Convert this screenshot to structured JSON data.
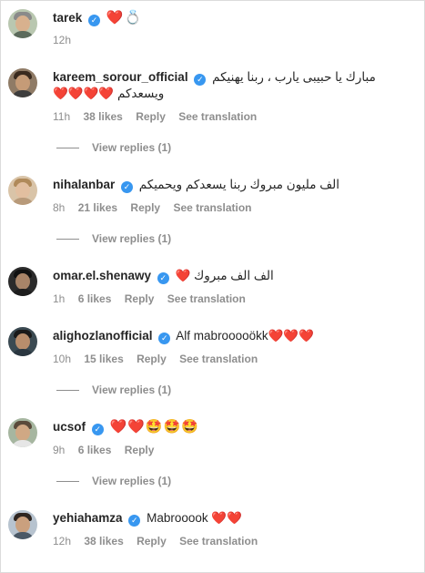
{
  "comments": [
    {
      "username": "tarek",
      "text": "❤️💍",
      "time": "12h",
      "likes": "",
      "reply": "",
      "translation": "",
      "view_replies": ""
    },
    {
      "username": "kareem_sorour_official",
      "text": "مبارك يا حبيبى يارب ، ربنا يهنيكم",
      "text2": "ويسعدكم ❤️❤️❤️❤️",
      "time": "11h",
      "likes": "38 likes",
      "reply": "Reply",
      "translation": "See translation",
      "view_replies": "View replies (1)"
    },
    {
      "username": "nihalanbar",
      "text": "الف مليون مبروك ربنا يسعدكم ويحميكم",
      "time": "8h",
      "likes": "21 likes",
      "reply": "Reply",
      "translation": "See translation",
      "view_replies": "View replies (1)"
    },
    {
      "username": "omar.el.shenawy",
      "text": "الف الف مبروك ❤️",
      "time": "1h",
      "likes": "6 likes",
      "reply": "Reply",
      "translation": "See translation",
      "view_replies": ""
    },
    {
      "username": "alighozlanofficial",
      "text": "Alf mabrooooökk❤️❤️❤️",
      "time": "10h",
      "likes": "15 likes",
      "reply": "Reply",
      "translation": "See translation",
      "view_replies": "View replies (1)"
    },
    {
      "username": "ucsof",
      "text": "❤️❤️🤩🤩🤩",
      "time": "9h",
      "likes": "6 likes",
      "reply": "Reply",
      "translation": "",
      "view_replies": "View replies (1)"
    },
    {
      "username": "yehiahamza",
      "text": "Mabrooook ❤️❤️",
      "time": "12h",
      "likes": "38 likes",
      "reply": "Reply",
      "translation": "See translation",
      "view_replies": ""
    }
  ],
  "colors": {
    "verified": "#3897f0",
    "meta_text": "#8e8e8e",
    "heart": "#ed1c24"
  }
}
